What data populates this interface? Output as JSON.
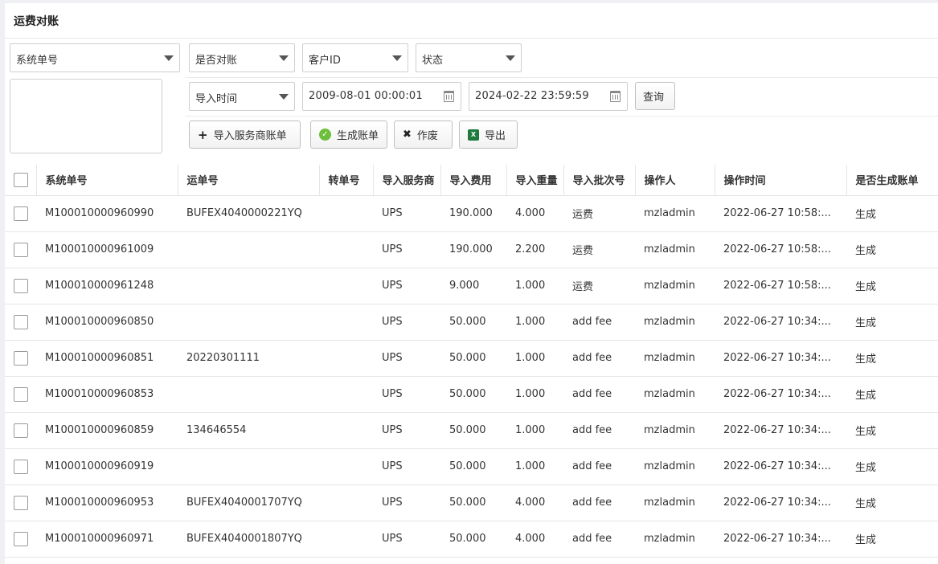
{
  "page": {
    "title": "运费对账"
  },
  "filters": {
    "system_no_select": "系统单号",
    "reconciled_select": "是否对账",
    "customer_select": "客户ID",
    "status_select": "状态",
    "time_type_select": "导入时间",
    "date_from": "2009-08-01 00:00:01",
    "date_to": "2024-02-22 23:59:59",
    "query_label": "查询"
  },
  "actions": {
    "import_label": "导入服务商账单",
    "generate_label": "生成账单",
    "void_label": "作废",
    "export_label": "导出"
  },
  "icons": {
    "select_caret": "caret-down-icon",
    "calendar": "calendar-icon",
    "import": "plus-icon",
    "generate": "check-circle-icon",
    "void": "x-icon",
    "export": "excel-icon"
  },
  "colors": {
    "generate_icon": "#6cbf3a",
    "export_icon": "#1f7a3b"
  },
  "table": {
    "headers": [
      "系统单号",
      "运单号",
      "转单号",
      "导入服务商",
      "导入费用",
      "导入重量",
      "导入批次号",
      "操作人",
      "操作时间",
      "是否生成账单"
    ],
    "rows": [
      [
        "M100010000960990",
        "BUFEX4040000221YQ",
        "",
        "UPS",
        "190.000",
        "4.000",
        "运费",
        "mzladmin",
        "2022-06-27 10:58:...",
        "生成"
      ],
      [
        "M100010000961009",
        "",
        "",
        "UPS",
        "190.000",
        "2.200",
        "运费",
        "mzladmin",
        "2022-06-27 10:58:...",
        "生成"
      ],
      [
        "M100010000961248",
        "",
        "",
        "UPS",
        "9.000",
        "1.000",
        "运费",
        "mzladmin",
        "2022-06-27 10:58:...",
        "生成"
      ],
      [
        "M100010000960850",
        "",
        "",
        "UPS",
        "50.000",
        "1.000",
        "add fee",
        "mzladmin",
        "2022-06-27 10:34:...",
        "生成"
      ],
      [
        "M100010000960851",
        "20220301111",
        "",
        "UPS",
        "50.000",
        "1.000",
        "add fee",
        "mzladmin",
        "2022-06-27 10:34:...",
        "生成"
      ],
      [
        "M100010000960853",
        "",
        "",
        "UPS",
        "50.000",
        "1.000",
        "add fee",
        "mzladmin",
        "2022-06-27 10:34:...",
        "生成"
      ],
      [
        "M100010000960859",
        "134646554",
        "",
        "UPS",
        "50.000",
        "1.000",
        "add fee",
        "mzladmin",
        "2022-06-27 10:34:...",
        "生成"
      ],
      [
        "M100010000960919",
        "",
        "",
        "UPS",
        "50.000",
        "1.000",
        "add fee",
        "mzladmin",
        "2022-06-27 10:34:...",
        "生成"
      ],
      [
        "M100010000960953",
        "BUFEX4040001707YQ",
        "",
        "UPS",
        "50.000",
        "4.000",
        "add fee",
        "mzladmin",
        "2022-06-27 10:34:...",
        "生成"
      ],
      [
        "M100010000960971",
        "BUFEX4040001807YQ",
        "",
        "UPS",
        "50.000",
        "4.000",
        "add fee",
        "mzladmin",
        "2022-06-27 10:34:...",
        "生成"
      ]
    ]
  }
}
